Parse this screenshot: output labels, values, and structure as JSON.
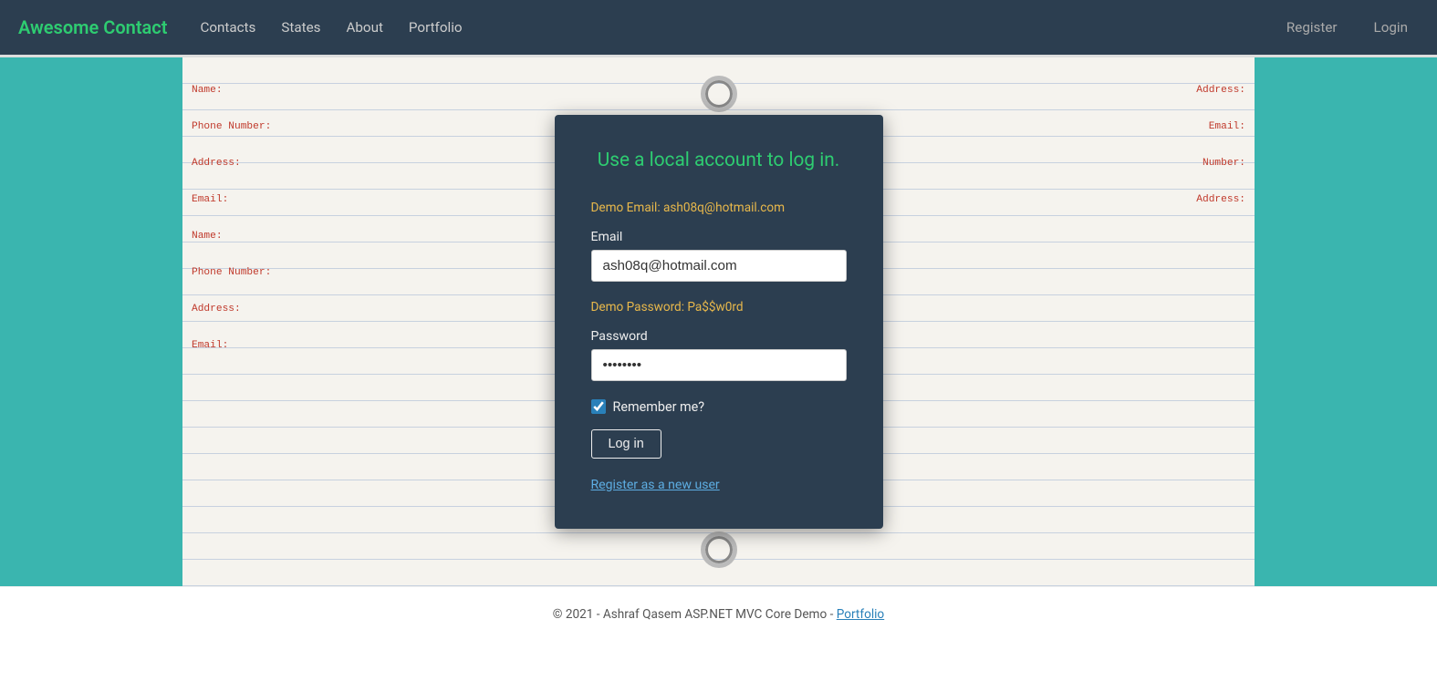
{
  "brand": "Awesome Contact",
  "nav": {
    "links": [
      {
        "label": "Contacts",
        "name": "nav-contacts"
      },
      {
        "label": "States",
        "name": "nav-states"
      },
      {
        "label": "About",
        "name": "nav-about"
      },
      {
        "label": "Portfolio",
        "name": "nav-portfolio"
      }
    ],
    "auth": [
      {
        "label": "Register",
        "name": "nav-register"
      },
      {
        "label": "Login",
        "name": "nav-login"
      }
    ]
  },
  "login": {
    "title": "Use a local account to log in.",
    "demo_email_label": "Demo Email: ash08q@hotmail.com",
    "demo_password_label": "Demo Password: Pa$$w0rd",
    "email_label": "Email",
    "email_value": "ash08q@hotmail.com",
    "password_label": "Password",
    "password_value": "••••••••••",
    "remember_label": "Remember me?",
    "login_button": "Log in",
    "register_link": "Register as a new user"
  },
  "footer": {
    "text": "© 2021 - Ashraf Qasem ASP.NET MVC Core Demo -",
    "portfolio_link": "Portfolio"
  },
  "colors": {
    "brand_green": "#2ecc71",
    "navbar_bg": "#2c3e50",
    "teal": "#3ab5af",
    "card_bg": "#2c3e50",
    "demo_color": "#e8b84b",
    "link_color": "#5dade2"
  }
}
